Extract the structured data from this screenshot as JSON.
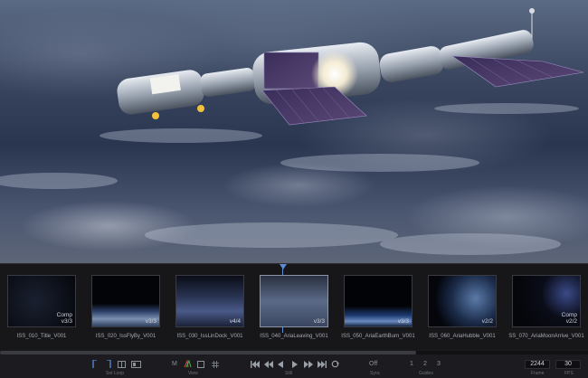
{
  "bin": {
    "clips": [
      {
        "name": "ISS_010_Title_V001",
        "overlay": "Comp\nv3/3",
        "selected": false
      },
      {
        "name": "ISS_020_IssFlyBy_V001",
        "overlay": "v3/3",
        "selected": false
      },
      {
        "name": "ISS_030_IssLinDock_V001",
        "overlay": "v4/4",
        "selected": false
      },
      {
        "name": "ISS_040_AriaLeaving_V001",
        "overlay": "v3/3",
        "selected": true
      },
      {
        "name": "ISS_050_AriaEarthBurn_V001",
        "overlay": "v3/3",
        "selected": false
      },
      {
        "name": "ISS_060_AriaHubble_V001",
        "overlay": "v2/2",
        "selected": false
      },
      {
        "name": "SS_070_AriaMoonArrive_V001",
        "overlay": "Comp\nv2/2",
        "selected": false
      }
    ]
  },
  "toolbar": {
    "set_loop_label": "Set Loop",
    "view_label": "View",
    "view_m": "M",
    "transport_label": "Still",
    "sync_value": "Off",
    "sync_label": "Sync",
    "guides_1": "1",
    "guides_2": "2",
    "guides_3": "3",
    "guides_label": "Guides",
    "frame_value": "2244",
    "frame_label": "Frame",
    "fps_value": "30",
    "fps_label": "FPS"
  },
  "colors": {
    "accent": "#5a8cd6",
    "background": "#17171a"
  },
  "icons": {
    "loop_in": "set-loop-in-icon",
    "loop_out": "set-loop-out-icon",
    "transport": [
      "go-to-start-icon",
      "step-back-icon",
      "play-reverse-icon",
      "play-icon",
      "step-forward-icon",
      "go-to-end-icon",
      "loop-icon"
    ]
  }
}
